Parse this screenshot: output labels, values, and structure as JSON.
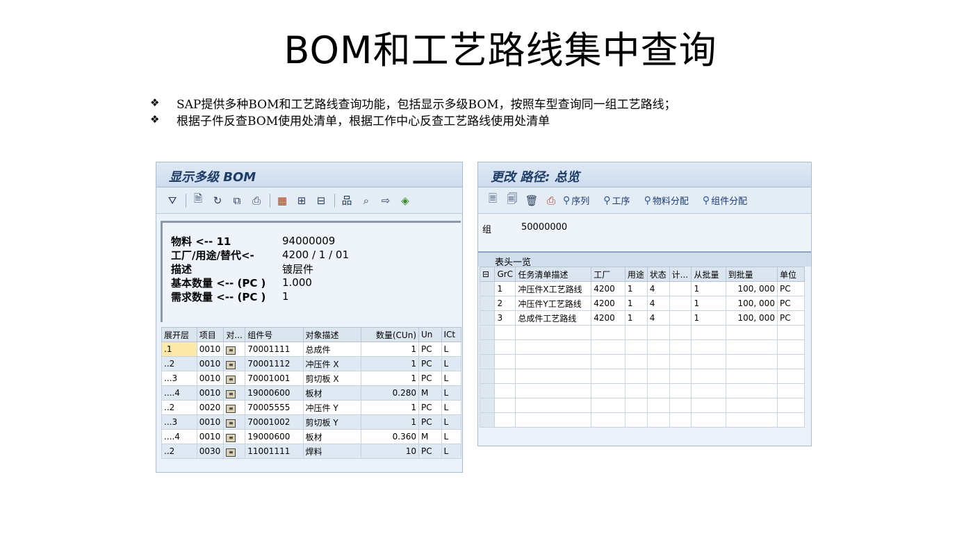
{
  "slide": {
    "title": "BOM和工艺路线集中查询",
    "bullets": [
      "SAP提供多种BOM和工艺路线查询功能，包括显示多级BOM，按照车型查询同一组工艺路线；",
      "根据子件反查BOM使用处清单，根据工作中心反查工艺路线使用处清单"
    ],
    "bullet_mark": "❖"
  },
  "bom_panel": {
    "title": "显示多级 BOM",
    "toolbar_icons": [
      "filter-icon",
      "doc-icon",
      "refresh-icon",
      "copy-icon",
      "print-icon",
      "grid-icon",
      "grid-add-icon",
      "grid-remove-icon",
      "hierarchy-icon",
      "search-doc-icon",
      "export-icon",
      "diamond-icon"
    ],
    "header": [
      {
        "label": "物料 <-- 11",
        "value": "94000009"
      },
      {
        "label": "工厂/用途/替代<-",
        "value": "4200 / 1 / 01"
      },
      {
        "label": "描述",
        "value": "镀层件"
      },
      {
        "label": "基本数量 <-- (PC )",
        "value": "1.000"
      },
      {
        "label": "需求数量 <-- (PC )",
        "value": "1"
      }
    ],
    "columns": [
      "展开层",
      "项目",
      "对...",
      "组件号",
      "对象描述",
      "数量(CUn)",
      "Un",
      "ICt"
    ],
    "rows": [
      {
        "level": ".1",
        "item": "0010",
        "comp": "70001111",
        "desc": "总成件",
        "qty": "1",
        "un": "PC",
        "ict": "L"
      },
      {
        "level": "..2",
        "item": "0010",
        "comp": "70001112",
        "desc": "冲压件 X",
        "qty": "1",
        "un": "PC",
        "ict": "L"
      },
      {
        "level": "...3",
        "item": "0010",
        "comp": "70001001",
        "desc": "剪切板 X",
        "qty": "1",
        "un": "PC",
        "ict": "L"
      },
      {
        "level": "....4",
        "item": "0010",
        "comp": "19000600",
        "desc": "板材",
        "qty": "0.280",
        "un": "M",
        "ict": "L"
      },
      {
        "level": "..2",
        "item": "0020",
        "comp": "70005555",
        "desc": "冲压件 Y",
        "qty": "1",
        "un": "PC",
        "ict": "L"
      },
      {
        "level": "...3",
        "item": "0010",
        "comp": "70001002",
        "desc": "剪切板 Y",
        "qty": "1",
        "un": "PC",
        "ict": "L"
      },
      {
        "level": "....4",
        "item": "0010",
        "comp": "19000600",
        "desc": "板材",
        "qty": "0.360",
        "un": "M",
        "ict": "L"
      },
      {
        "level": "..2",
        "item": "0030",
        "comp": "11001111",
        "desc": "焊料",
        "qty": "10",
        "un": "PC",
        "ict": "L"
      }
    ]
  },
  "route_panel": {
    "title": "更改 路径: 总览",
    "toolbar_buttons": [
      "序列",
      "工序",
      "物料分配",
      "组件分配"
    ],
    "group_label": "组",
    "group_value": "50000000",
    "subsection": "表头一览",
    "columns": [
      "GrC",
      "任务清单描述",
      "工厂",
      "用途",
      "状态",
      "计...",
      "从批量",
      "到批量",
      "单位"
    ],
    "rows": [
      {
        "grc": "1",
        "desc": "冲压件X工艺路线",
        "plant": "4200",
        "usage": "1",
        "status": "4",
        "plan": "",
        "from": "1",
        "to": "100, 000",
        "unit": "PC"
      },
      {
        "grc": "2",
        "desc": "冲压件Y工艺路线",
        "plant": "4200",
        "usage": "1",
        "status": "4",
        "plan": "",
        "from": "1",
        "to": "100, 000",
        "unit": "PC"
      },
      {
        "grc": "3",
        "desc": "总成件工艺路线",
        "plant": "4200",
        "usage": "1",
        "status": "4",
        "plan": "",
        "from": "1",
        "to": "100, 000",
        "unit": "PC"
      }
    ],
    "empty_rows": 7
  }
}
